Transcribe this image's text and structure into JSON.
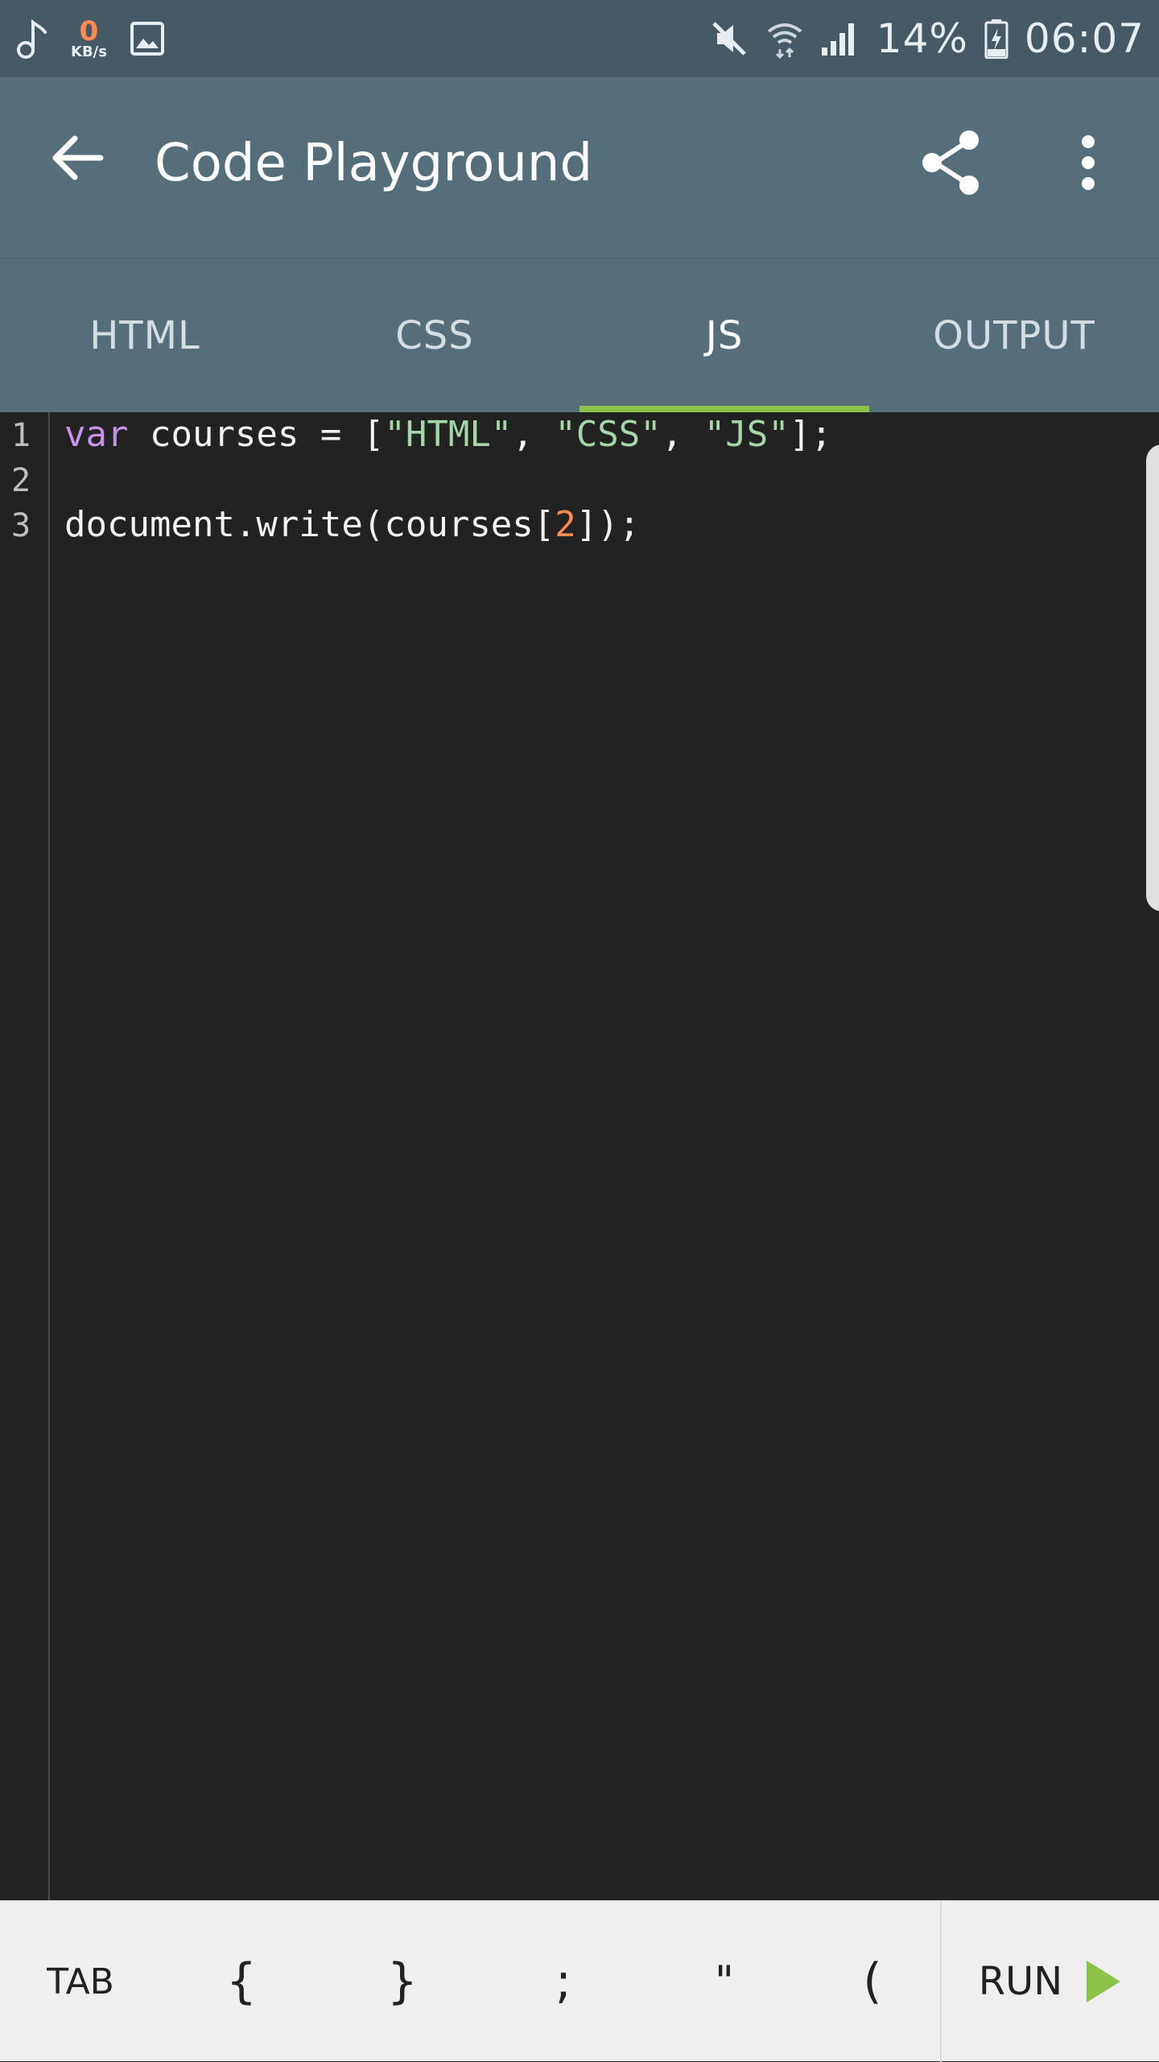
{
  "status_bar": {
    "net_speed_value": "0",
    "net_speed_unit": "KB/s",
    "battery": "14%",
    "time": "06:07",
    "left_icons": [
      "music-note-icon",
      "image-icon"
    ],
    "right_icons": [
      "mute-icon",
      "wifi-icon",
      "signal-icon",
      "battery-charging-icon"
    ]
  },
  "app_bar": {
    "title": "Code Playground",
    "icons": [
      "back-arrow-icon",
      "share-icon",
      "more-vert-icon"
    ]
  },
  "tabs": [
    {
      "label": "HTML",
      "active": false
    },
    {
      "label": "CSS",
      "active": false
    },
    {
      "label": "JS",
      "active": true
    },
    {
      "label": "OUTPUT",
      "active": false
    }
  ],
  "editor": {
    "line_numbers": [
      "1",
      "2",
      "3"
    ],
    "line1": {
      "keyword": "var",
      "plain1": " courses = [",
      "str1": "\"HTML\"",
      "sep1": ", ",
      "str2": "\"CSS\"",
      "sep2": ", ",
      "str3": "\"JS\"",
      "end": "];"
    },
    "line2": "",
    "line3": {
      "plain1": "document.write(courses[",
      "number": "2",
      "end": "]);"
    }
  },
  "toolbar": {
    "keys": [
      "TAB",
      "{",
      "}",
      ";",
      "\"",
      "("
    ],
    "run_label": "RUN",
    "run_icon": "play-icon"
  },
  "colors": {
    "status_bar": "#455a64",
    "app_bar": "#546e7a",
    "tab_indicator": "#8bc34a",
    "editor_bg": "#222222",
    "keyword": "#c792ea",
    "string": "#a5d6a7",
    "number": "#ff8a50",
    "run_play": "#8bc34a"
  }
}
